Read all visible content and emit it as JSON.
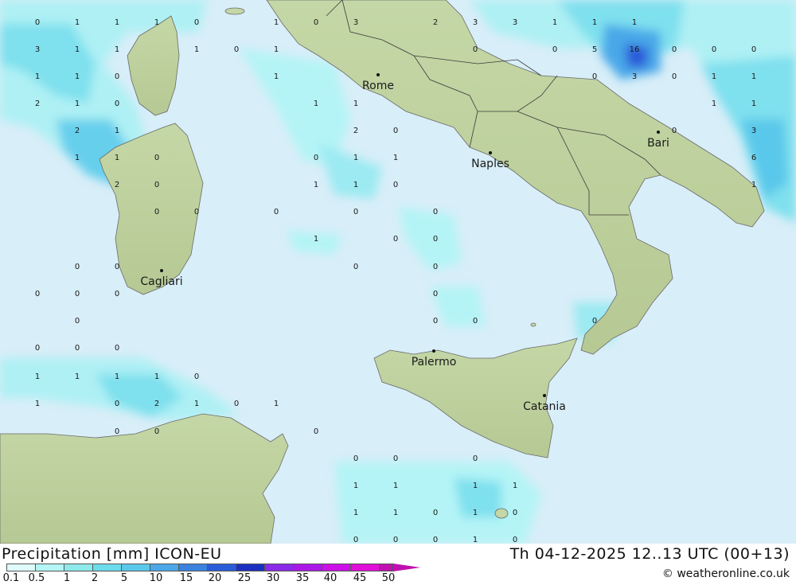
{
  "map": {
    "cities": [
      {
        "name": "Rome"
      },
      {
        "name": "Naples"
      },
      {
        "name": "Bari"
      },
      {
        "name": "Cagliari"
      },
      {
        "name": "Palermo"
      },
      {
        "name": "Catania"
      }
    ],
    "values": [
      [
        "0",
        "1",
        "1",
        "1",
        "0",
        "1",
        "0",
        "3",
        "2",
        "3",
        "3",
        "1",
        "1",
        "1"
      ],
      [
        "3",
        "1",
        "1",
        "1",
        "0",
        "1",
        "0",
        "0",
        "5",
        "16",
        "0",
        "0",
        "0"
      ],
      [
        "1",
        "1",
        "0",
        "1",
        "0",
        "3",
        "0",
        "1",
        "1"
      ],
      [
        "2",
        "1",
        "0",
        "1",
        "1",
        "1",
        "1"
      ],
      [
        "2",
        "1",
        "2",
        "0",
        "0",
        "3"
      ],
      [
        "1",
        "1",
        "0",
        "0",
        "1",
        "1",
        "6"
      ],
      [
        "2",
        "0",
        "1",
        "1",
        "0",
        "1"
      ],
      [
        "0",
        "0",
        "0",
        "0",
        "0"
      ],
      [
        "1",
        "0",
        "0"
      ],
      [
        "0",
        "0",
        "0",
        "0"
      ],
      [
        "0",
        "0",
        "0",
        "0"
      ],
      [
        "0",
        "0",
        "0",
        "0",
        "1"
      ],
      [
        "0",
        "0",
        "0"
      ],
      [
        "1",
        "1",
        "1",
        "1",
        "0"
      ],
      [
        "1",
        "0",
        "2",
        "1",
        "0",
        "1"
      ],
      [
        "0",
        "0",
        "0"
      ],
      [
        "0",
        "0",
        "0"
      ],
      [
        "1",
        "1",
        "1",
        "1"
      ],
      [
        "1",
        "1",
        "0",
        "1",
        "0"
      ],
      [
        "0",
        "0",
        "0",
        "1",
        "0"
      ]
    ]
  },
  "footer": {
    "title": "Precipitation [mm] ICON-EU",
    "datetime": "Th 04-12-2025 12..13 UTC (00+13)",
    "credit": "© weatheronline.co.uk",
    "scale_ticks": [
      "0.1",
      "0.5",
      "1",
      "2",
      "5",
      "10",
      "15",
      "20",
      "25",
      "30",
      "35",
      "40",
      "45",
      "50"
    ],
    "scale_colors": [
      "#e0fbfb",
      "#b4f5f5",
      "#8eeaea",
      "#6cdcec",
      "#5ac8ea",
      "#4aa8e8",
      "#3a82e0",
      "#2a5cd8",
      "#1c30c0",
      "#8a2ae8",
      "#aa18e8",
      "#cc10e8",
      "#e010d8",
      "#c010b0"
    ]
  }
}
